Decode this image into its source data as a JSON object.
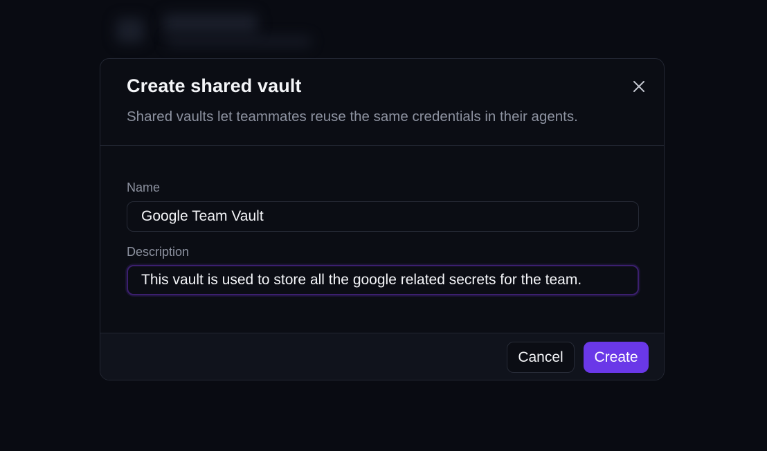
{
  "dialog": {
    "title": "Create shared vault",
    "subtitle": "Shared vaults let teammates reuse the same credentials in their agents.",
    "close_icon": "close-icon"
  },
  "form": {
    "name_label": "Name",
    "name_value": "Google Team Vault",
    "description_label": "Description",
    "description_value": "This vault is used to store all the google related secrets for the team."
  },
  "footer": {
    "cancel_label": "Cancel",
    "create_label": "Create"
  },
  "colors": {
    "background": "#090b12",
    "dialog": "#0b0d14",
    "accent": "#6a38e8",
    "focus_ring": "#3b1f6e"
  }
}
